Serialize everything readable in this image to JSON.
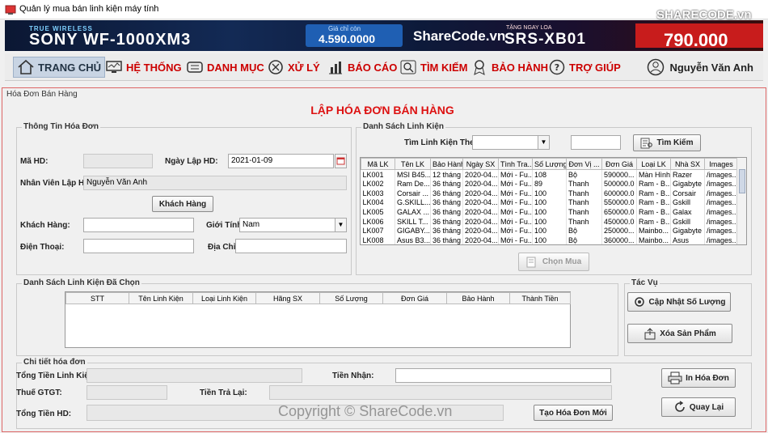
{
  "window": {
    "title": "Quản lý mua bán linh kiện máy tính"
  },
  "banner": {
    "line1": "TRUE WIRELESS",
    "product": "SONY WF-1000XM3",
    "price_label": "Giá chỉ còn",
    "price": "4.590.0000",
    "gift_label": "TẶNG NGAY LOA",
    "gift": "SRS-XB01",
    "price2": "790.000",
    "logo": "SHARECODE.vn",
    "watermark": "ShareCode.vn"
  },
  "menu": {
    "items": [
      {
        "label": "TRANG CHỦ",
        "icon": "home-icon"
      },
      {
        "label": "HỆ THỐNG",
        "icon": "system-monitor-icon"
      },
      {
        "label": "DANH MỤC",
        "icon": "list-icon"
      },
      {
        "label": "XỬ LÝ",
        "icon": "process-icon"
      },
      {
        "label": "BÁO CÁO",
        "icon": "report-icon"
      },
      {
        "label": "TÌM KIẾM",
        "icon": "search-icon"
      },
      {
        "label": "BẢO HÀNH",
        "icon": "warranty-badge-icon"
      },
      {
        "label": "TRỢ GIÚP",
        "icon": "help-icon"
      }
    ],
    "user": "Nguyễn Văn Anh"
  },
  "main": {
    "panel_title": "Hóa Đơn Bán Hàng",
    "heading": "LẬP HÓA ĐƠN BÁN HÀNG"
  },
  "invoice_info": {
    "group_title": "Thông Tin Hóa Đơn",
    "invoice_id_label": "Mã HD:",
    "invoice_id_value": "",
    "date_label": "Ngày Lập HD:",
    "date_value": "2021-01-09",
    "staff_label": "Nhân Viên Lập HD:",
    "staff_value": "Nguyễn Văn Anh",
    "customer_button": "Khách Hàng",
    "customer_label": "Khách Hàng:",
    "customer_value": "",
    "gender_label": "Giới Tính:",
    "gender_value": "Nam",
    "phone_label": "Điện Thoại:",
    "phone_value": "",
    "address_label": "Địa Chỉ:",
    "address_value": ""
  },
  "component_list": {
    "group_title": "Danh Sách Linh Kiện",
    "search_by_label": "Tìm Linh Kiện Theo:",
    "search_by_value": "",
    "search_value": "",
    "search_button": "Tìm Kiếm",
    "columns": [
      "Mã LK",
      "Tên LK",
      "Bảo Hành",
      "Ngày SX",
      "Tình Tra...",
      "Số Lượng",
      "Đơn Vị ...",
      "Đơn Giá",
      "Loại LK",
      "Nhà SX",
      "Images"
    ],
    "rows": [
      [
        "LK001",
        "MSI B45...",
        "12 tháng",
        "2020-04...",
        "Mới - Fu...",
        "108",
        "Bộ",
        "590000...",
        "Màn Hình",
        "Razer",
        "/images..."
      ],
      [
        "LK002",
        "Ram De...",
        "36 tháng",
        "2020-04...",
        "Mới - Fu...",
        "89",
        "Thanh",
        "500000.0",
        "Ram - B...",
        "Gigabyte",
        "/images..."
      ],
      [
        "LK003",
        "Corsair ...",
        "36 tháng",
        "2020-04...",
        "Mới - Fu...",
        "100",
        "Thanh",
        "600000.0",
        "Ram - B...",
        "Corsair",
        "/images..."
      ],
      [
        "LK004",
        "G.SKILL...",
        "36 tháng",
        "2020-04...",
        "Mới - Fu...",
        "100",
        "Thanh",
        "550000.0",
        "Ram - B...",
        "Gskill",
        "/images..."
      ],
      [
        "LK005",
        "GALAX ...",
        "36 tháng",
        "2020-04...",
        "Mới - Fu...",
        "100",
        "Thanh",
        "650000.0",
        "Ram - B...",
        "Galax",
        "/images..."
      ],
      [
        "LK006",
        "SKILL T...",
        "36 tháng",
        "2020-04...",
        "Mới - Fu...",
        "100",
        "Thanh",
        "450000.0",
        "Ram - B...",
        "Gskill",
        "/images..."
      ],
      [
        "LK007",
        "GIGABY...",
        "36 tháng",
        "2020-04...",
        "Mới - Fu...",
        "100",
        "Bộ",
        "250000...",
        "Mainbo...",
        "Gigabyte",
        "/images..."
      ],
      [
        "LK008",
        "Asus B3...",
        "36 tháng",
        "2020-04...",
        "Mới - Fu...",
        "100",
        "Bộ",
        "360000...",
        "Mainbo...",
        "Asus",
        "/images..."
      ]
    ],
    "buy_button": "Chọn Mua"
  },
  "selected_list": {
    "group_title": "Danh Sách Linh Kiện Đã Chọn",
    "columns": [
      "STT",
      "Tên Linh Kiện",
      "Loại Linh Kiện",
      "Hãng SX",
      "Số Lượng",
      "Đơn Giá",
      "Bảo Hành",
      "Thành Tiền"
    ]
  },
  "actions": {
    "group_title": "Tác Vụ",
    "update_qty": "Cập Nhật Số Lượng",
    "delete_product": "Xóa Sản Phẩm"
  },
  "invoice_detail": {
    "group_title": "Chi tiết hóa đơn",
    "total_parts_label": "Tổng Tiền Linh Kiện:",
    "vat_label": "Thuế GTGT:",
    "total_invoice_label": "Tổng Tiền HD:",
    "received_label": "Tiền Nhận:",
    "change_label": "Tiền Trả Lại:",
    "new_invoice_button": "Tạo Hóa Đơn Mới",
    "print_button": "In Hóa Đơn",
    "back_button": "Quay Lại",
    "copyright": "Copyright © ShareCode.vn"
  }
}
